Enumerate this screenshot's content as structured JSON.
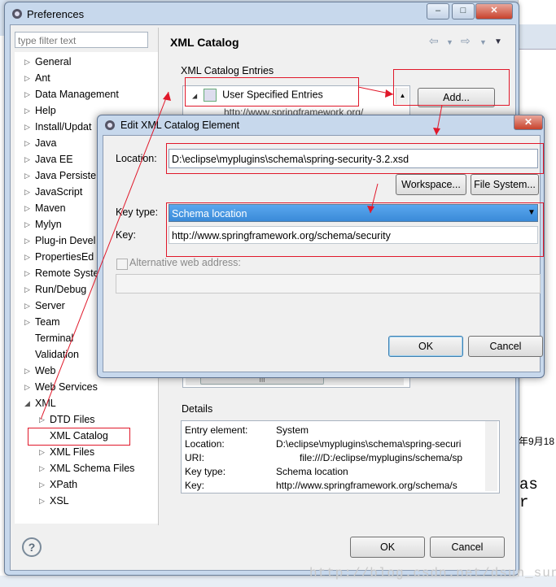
{
  "preferences": {
    "title": "Preferences",
    "filter_placeholder": "type filter text",
    "page_title": "XML Catalog",
    "catalog_entries_label": "XML Catalog Entries",
    "user_specified_entries": "User Specified Entries",
    "add_button": "Add...",
    "partial_entry": "http://www.springframework.org/",
    "details_label": "Details",
    "details": [
      {
        "key": "Entry element:",
        "value": "System"
      },
      {
        "key": "Location:",
        "value": "D:\\eclipse\\myplugins\\schema\\spring-securi"
      },
      {
        "key": "URI:",
        "value": "file:///D:/eclipse/myplugins/schema/sp"
      },
      {
        "key": "Key type:",
        "value": "Schema location"
      },
      {
        "key": "Key:",
        "value": "http://www.springframework.org/schema/s"
      }
    ],
    "ok_button": "OK",
    "cancel_button": "Cancel",
    "tree": [
      {
        "label": "General"
      },
      {
        "label": "Ant"
      },
      {
        "label": "Data Management"
      },
      {
        "label": "Help"
      },
      {
        "label": "Install/Updat"
      },
      {
        "label": "Java"
      },
      {
        "label": "Java EE"
      },
      {
        "label": "Java Persiste"
      },
      {
        "label": "JavaScript"
      },
      {
        "label": "Maven"
      },
      {
        "label": "Mylyn"
      },
      {
        "label": "Plug-in Devel"
      },
      {
        "label": "PropertiesEd"
      },
      {
        "label": "Remote Syste"
      },
      {
        "label": "Run/Debug"
      },
      {
        "label": "Server"
      },
      {
        "label": "Team"
      },
      {
        "label": "Terminal"
      },
      {
        "label": "Validation"
      },
      {
        "label": "Web"
      },
      {
        "label": "Web Services"
      },
      {
        "label": "XML"
      },
      {
        "label": "DTD Files"
      },
      {
        "label": "XML Catalog"
      },
      {
        "label": "XML Files"
      },
      {
        "label": "XML Schema Files"
      },
      {
        "label": "XPath"
      },
      {
        "label": "XSL"
      }
    ]
  },
  "dialog": {
    "title": "Edit XML Catalog Element",
    "location_label": "Location:",
    "location_value": "D:\\eclipse\\myplugins\\schema\\spring-security-3.2.xsd",
    "workspace_button": "Workspace...",
    "filesystem_button": "File System...",
    "key_type_label": "Key type:",
    "key_type_value": "Schema location",
    "key_label": "Key:",
    "key_value": "http://www.springframework.org/schema/security",
    "alt_label": "Alternative web address:",
    "ok_button": "OK",
    "cancel_button": "Cancel"
  },
  "background": {
    "watermark": "http://blog.csdn.net/dsun_sun",
    "cal_text": "年9月18",
    "as_text": "as r"
  }
}
